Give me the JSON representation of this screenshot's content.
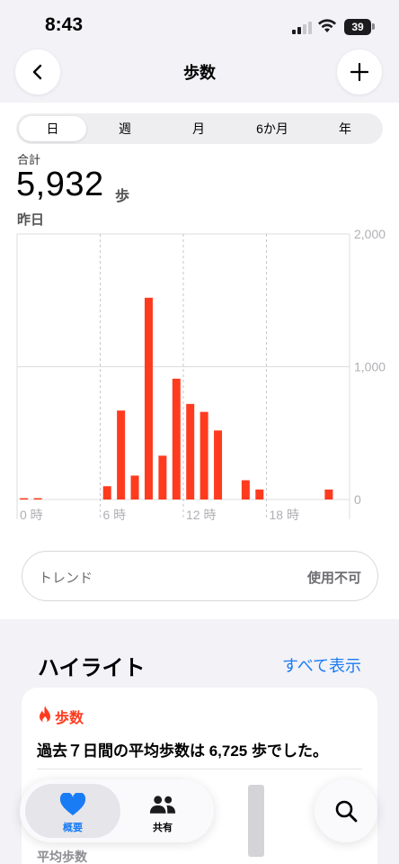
{
  "status": {
    "time": "8:43",
    "battery": "39"
  },
  "nav": {
    "title": "歩数"
  },
  "segments": [
    "日",
    "週",
    "月",
    "6か月",
    "年"
  ],
  "summary": {
    "label": "合計",
    "value": "5,932",
    "unit": "歩",
    "date": "昨日"
  },
  "chart_data": {
    "type": "bar",
    "x_tick_labels": [
      "0 時",
      "6 時",
      "12 時",
      "18 時"
    ],
    "y_tick_labels": [
      "2,000",
      "1,000",
      "0"
    ],
    "ylim": [
      0,
      2000
    ],
    "x": [
      0,
      1,
      2,
      3,
      4,
      5,
      6,
      7,
      8,
      9,
      10,
      11,
      12,
      13,
      14,
      15,
      16,
      17,
      18,
      19,
      20,
      21,
      22,
      23
    ],
    "values": [
      10,
      10,
      0,
      0,
      0,
      0,
      100,
      670,
      180,
      1520,
      330,
      910,
      720,
      660,
      520,
      0,
      145,
      75,
      0,
      0,
      0,
      0,
      75,
      0
    ],
    "bar_color": "#ff3b1f",
    "grid": true
  },
  "trend": {
    "label": "トレンド",
    "status": "使用不可"
  },
  "highlights": {
    "title": "ハイライト",
    "link": "すべて表示",
    "card": {
      "category": "歩数",
      "text": "過去７日間の平均歩数は 6,725 歩でした。",
      "sub": "平均歩数"
    }
  },
  "tabbar": {
    "tabs": [
      {
        "label": "概要",
        "active": true
      },
      {
        "label": "共有",
        "active": false
      }
    ]
  },
  "colors": {
    "accent": "#1a7cf5",
    "steps": "#ff3b1f"
  }
}
